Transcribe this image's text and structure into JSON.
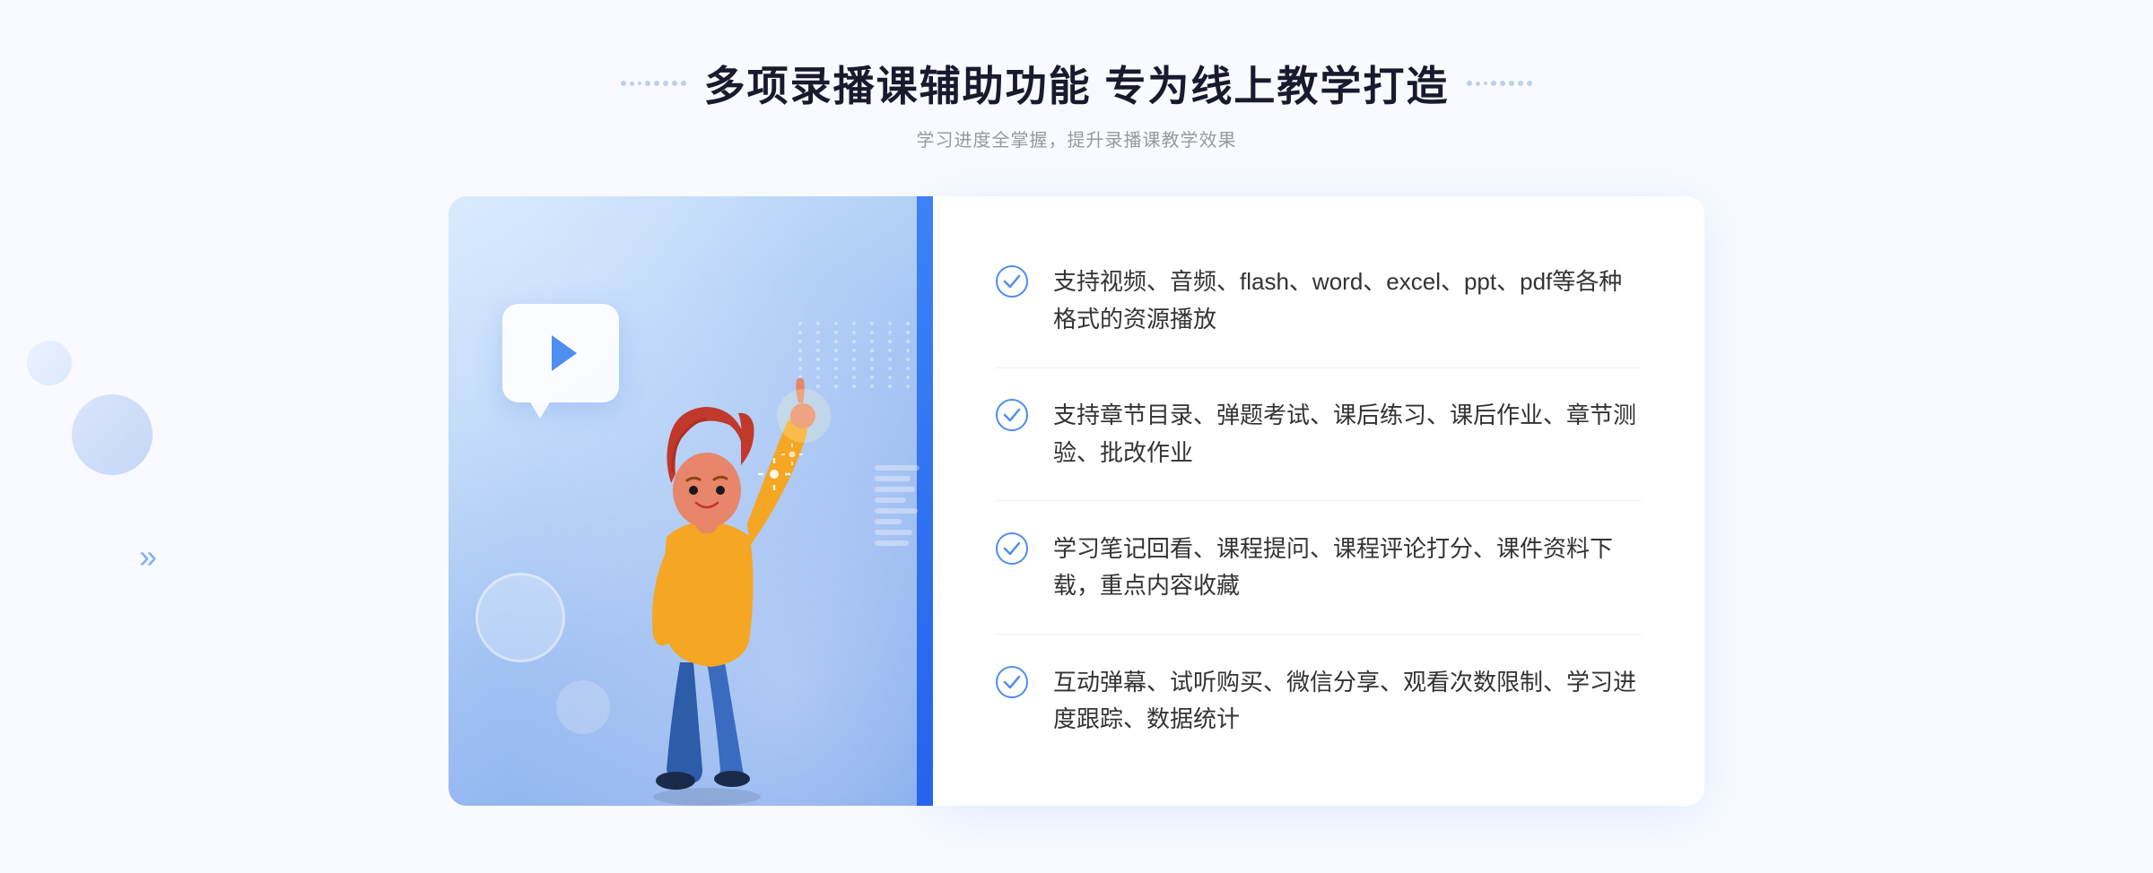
{
  "page": {
    "background": "#f8faff"
  },
  "header": {
    "main_title": "多项录播课辅助功能 专为线上教学打造",
    "sub_title": "学习进度全掌握，提升录播课教学效果"
  },
  "features": [
    {
      "id": 1,
      "text": "支持视频、音频、flash、word、excel、ppt、pdf等各种格式的资源播放"
    },
    {
      "id": 2,
      "text": "支持章节目录、弹题考试、课后练习、课后作业、章节测验、批改作业"
    },
    {
      "id": 3,
      "text": "学习笔记回看、课程提问、课程评论打分、课件资料下载，重点内容收藏"
    },
    {
      "id": 4,
      "text": "互动弹幕、试听购买、微信分享、观看次数限制、学习进度跟踪、数据统计"
    }
  ],
  "icons": {
    "check": "check-circle",
    "play": "play-triangle",
    "chevron": "»"
  }
}
